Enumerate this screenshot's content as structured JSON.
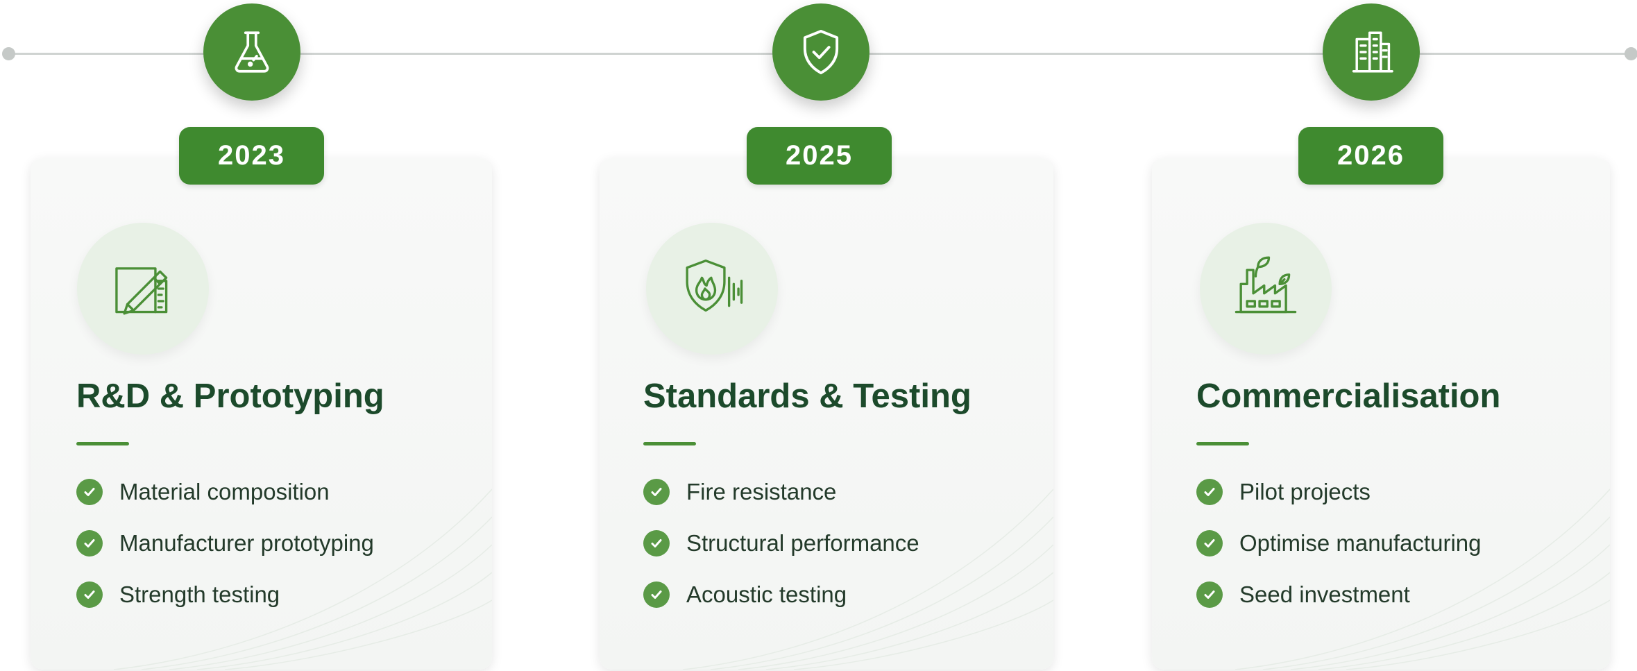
{
  "colors": {
    "accent": "#4a8f36",
    "badge": "#3f8a2f",
    "title": "#1c4a2b",
    "icon_bg": "#e8f1e6"
  },
  "phases": [
    {
      "year": "2023",
      "milestone_icon": "flask-icon",
      "phase_icon": "drafting-pencil-ruler-icon",
      "title": "R&D & Prototyping",
      "items": [
        "Material composition",
        "Manufacturer prototyping",
        "Strength testing"
      ]
    },
    {
      "year": "2025",
      "milestone_icon": "shield-check-icon",
      "phase_icon": "fire-shield-sound-icon",
      "title": "Standards & Testing",
      "items": [
        "Fire resistance",
        "Structural performance",
        "Acoustic testing"
      ]
    },
    {
      "year": "2026",
      "milestone_icon": "buildings-icon",
      "phase_icon": "factory-leaf-icon",
      "title": "Commercialisation",
      "items": [
        "Pilot projects",
        "Optimise manufacturing",
        "Seed investment"
      ]
    }
  ]
}
